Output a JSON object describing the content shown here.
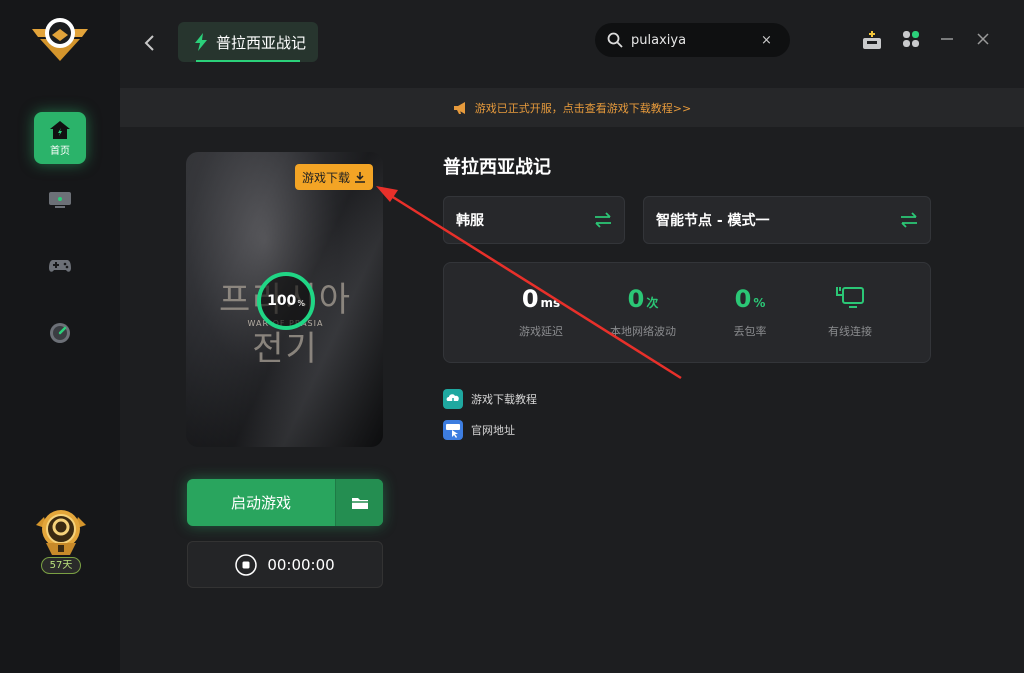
{
  "sidebar": {
    "items": [
      {
        "label": "首页",
        "icon": "home-icon",
        "active": true
      },
      {
        "label": "",
        "icon": "monitor-icon"
      },
      {
        "label": "",
        "icon": "gamepad-icon"
      },
      {
        "label": "",
        "icon": "speedometer-icon"
      }
    ],
    "days_badge": "57天"
  },
  "header": {
    "title": "普拉西亚战记",
    "search_value": "pulaxiya",
    "clear_symbol": "×"
  },
  "notice": {
    "text": "游戏已正式开服，点击查看游戏下载教程>>"
  },
  "cover": {
    "title_art": "프라시아 전기",
    "subtitle_art": "WAR OF PRASIA",
    "download_label": "游戏下载",
    "progress_value": "100",
    "progress_unit": "%"
  },
  "launch": {
    "label": "启动游戏",
    "timer": "00:00:00"
  },
  "game": {
    "name": "普拉西亚战记",
    "server": "韩服",
    "node": "智能节点 - 模式一"
  },
  "stats": [
    {
      "value": "0",
      "unit": "ms",
      "label": "游戏延迟"
    },
    {
      "value": "0",
      "unit": "次",
      "label": "本地网络波动"
    },
    {
      "value": "0",
      "unit": "%",
      "label": "丢包率"
    },
    {
      "value": "",
      "unit": "",
      "label": "有线连接"
    }
  ],
  "links": {
    "tutorial": "游戏下载教程",
    "website": "官网地址"
  },
  "colors": {
    "accent": "#2bb36a",
    "download": "#f3a425",
    "notice": "#e69a3c",
    "annotation_arrow": "#e8302a"
  }
}
